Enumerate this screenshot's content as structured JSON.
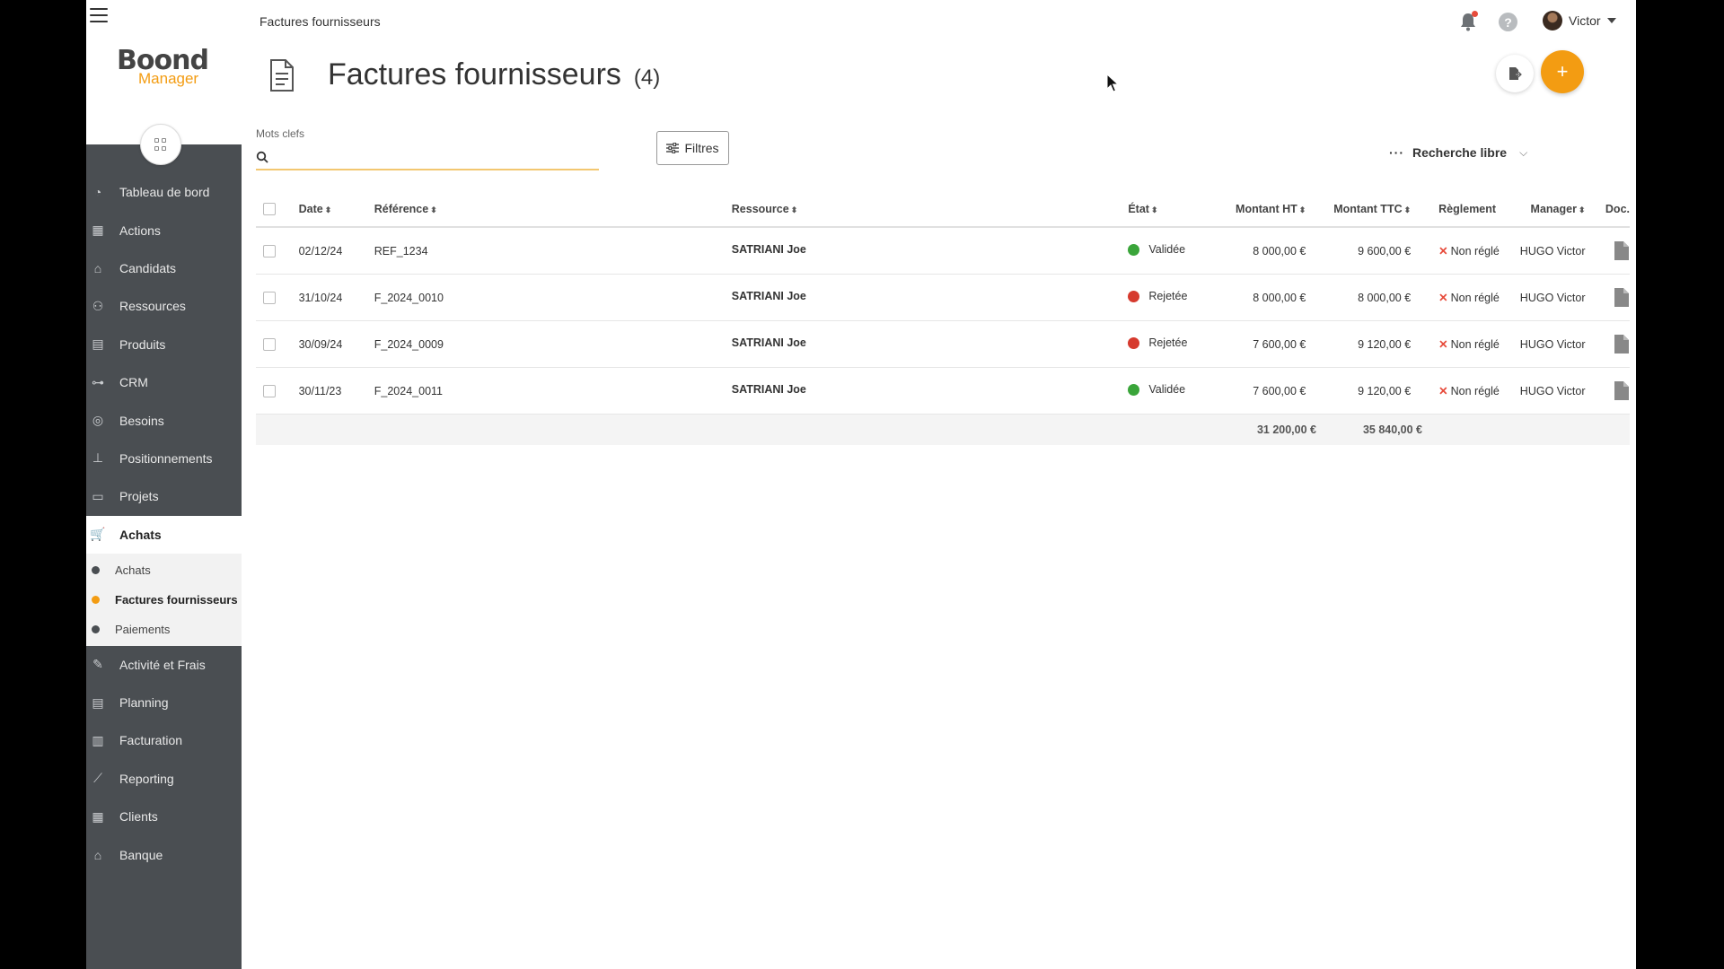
{
  "app": {
    "logo_main": "Boond",
    "logo_sub": "Manager"
  },
  "sidebar": {
    "items": [
      {
        "label": "Tableau de bord",
        "icon": "dashboard-icon",
        "glyph": "◔"
      },
      {
        "label": "Actions",
        "icon": "calendar-check-icon",
        "glyph": "▦"
      },
      {
        "label": "Candidats",
        "icon": "graduation-cap-icon",
        "glyph": "⌂"
      },
      {
        "label": "Ressources",
        "icon": "users-icon",
        "glyph": "⚇"
      },
      {
        "label": "Produits",
        "icon": "book-icon",
        "glyph": "▤"
      },
      {
        "label": "CRM",
        "icon": "org-chart-icon",
        "glyph": "⊶"
      },
      {
        "label": "Besoins",
        "icon": "target-icon",
        "glyph": "◎"
      },
      {
        "label": "Positionnements",
        "icon": "pin-icon",
        "glyph": "⊥"
      },
      {
        "label": "Projets",
        "icon": "briefcase-icon",
        "glyph": "▭"
      }
    ],
    "active": {
      "label": "Achats",
      "icon": "cart-icon",
      "glyph": "🛒"
    },
    "subitems": [
      {
        "label": "Achats"
      },
      {
        "label": "Factures fournisseurs"
      },
      {
        "label": "Paiements"
      }
    ],
    "items_after": [
      {
        "label": "Activité et Frais",
        "icon": "edit-icon",
        "glyph": "✎"
      },
      {
        "label": "Planning",
        "icon": "planning-icon",
        "glyph": "▤"
      },
      {
        "label": "Facturation",
        "icon": "invoice-icon",
        "glyph": "▥"
      },
      {
        "label": "Reporting",
        "icon": "line-chart-icon",
        "glyph": "⟋"
      },
      {
        "label": "Clients",
        "icon": "building-icon",
        "glyph": "▦"
      },
      {
        "label": "Banque",
        "icon": "bank-icon",
        "glyph": "⌂"
      }
    ]
  },
  "topbar": {
    "breadcrumb": "Factures fournisseurs",
    "user_name": "Victor",
    "help_glyph": "?"
  },
  "header": {
    "title": "Factures fournisseurs",
    "count": "(4)",
    "add_glyph": "+"
  },
  "search": {
    "label": "Mots clefs",
    "value": "",
    "placeholder": ""
  },
  "filters_label": "Filtres",
  "free_search": {
    "dots": "···",
    "label": "Recherche libre",
    "chevron": "⌵"
  },
  "table": {
    "headers": {
      "date": "Date",
      "reference": "Référence",
      "ressource": "Ressource",
      "etat": "État",
      "montant_ht": "Montant HT",
      "montant_ttc": "Montant TTC",
      "reglement": "Règlement",
      "manager": "Manager",
      "doc": "Doc."
    },
    "sort_glyph": "⬍",
    "rows": [
      {
        "date": "02/12/24",
        "reference": "REF_1234",
        "ressource": "SATRIANI Joe",
        "etat": "Validée",
        "etat_color": "#3aa53a",
        "montant_ht": "8 000,00 €",
        "montant_ttc": "9 600,00 €",
        "reglement": "Non réglé",
        "manager": "HUGO Victor"
      },
      {
        "date": "31/10/24",
        "reference": "F_2024_0010",
        "ressource": "SATRIANI Joe",
        "etat": "Rejetée",
        "etat_color": "#d63a2e",
        "montant_ht": "8 000,00 €",
        "montant_ttc": "8 000,00 €",
        "reglement": "Non réglé",
        "manager": "HUGO Victor"
      },
      {
        "date": "30/09/24",
        "reference": "F_2024_0009",
        "ressource": "SATRIANI Joe",
        "etat": "Rejetée",
        "etat_color": "#d63a2e",
        "montant_ht": "7 600,00 €",
        "montant_ttc": "9 120,00 €",
        "reglement": "Non réglé",
        "manager": "HUGO Victor"
      },
      {
        "date": "30/11/23",
        "reference": "F_2024_0011",
        "ressource": "SATRIANI Joe",
        "etat": "Validée",
        "etat_color": "#3aa53a",
        "montant_ht": "7 600,00 €",
        "montant_ttc": "9 120,00 €",
        "reglement": "Non réglé",
        "manager": "HUGO Victor"
      }
    ],
    "totals": {
      "montant_ht": "31 200,00 €",
      "montant_ttc": "35 840,00 €"
    },
    "reglement_glyph": "✕"
  },
  "colors": {
    "accent": "#f39c12",
    "sidebar": "#4a4e52",
    "valid": "#3aa53a",
    "rejected": "#d63a2e"
  }
}
